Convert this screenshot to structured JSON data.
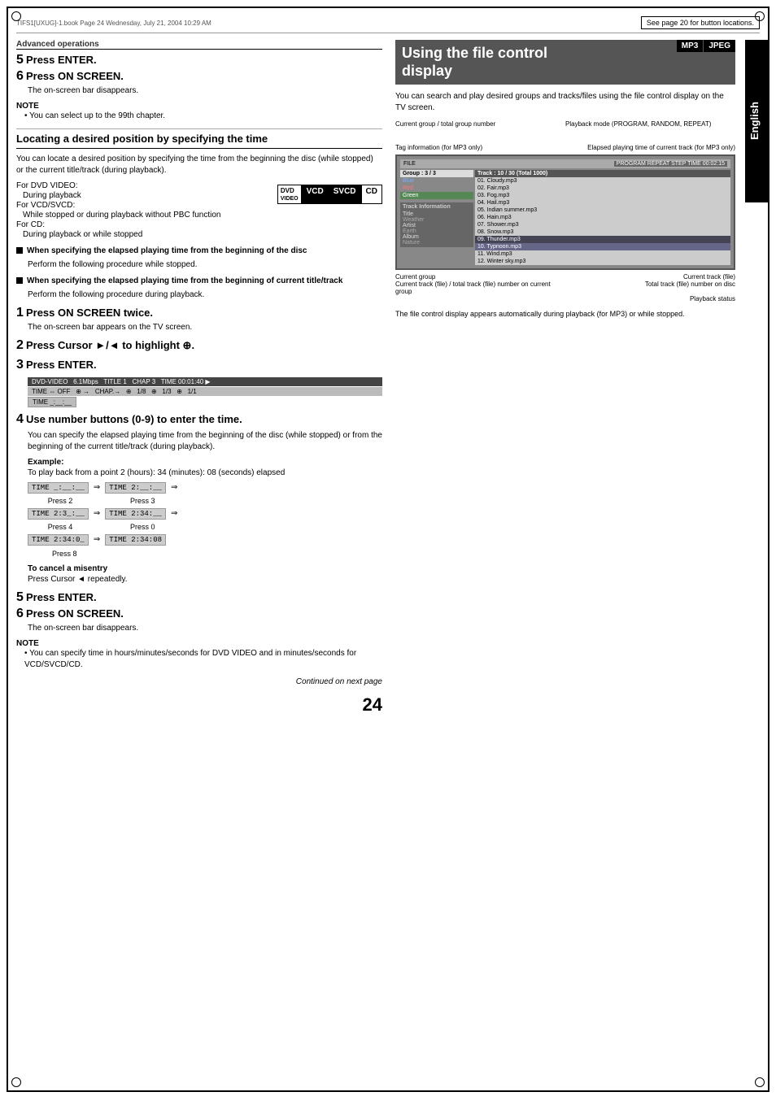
{
  "page": {
    "number": "24",
    "filename": "TIFS1[UXUG]-1.book  Page 24  Wednesday, July 21, 2004  10:29 AM",
    "see_page_note": "See page 20 for button locations.",
    "continued": "Continued on next page"
  },
  "left_column": {
    "section_header": "Advanced operations",
    "step5_num": "5",
    "step5_title": "Press ENTER.",
    "step6_num": "6",
    "step6_title": "Press ON SCREEN.",
    "step6_sub": "The on-screen bar disappears.",
    "note_label": "NOTE",
    "note_bullet": "You can select up to the 99th chapter.",
    "subsection_title": "Locating a desired position by specifying the time",
    "body_text1": "You can locate a desired position by specifying the time from the beginning the disc (while stopped) or the current title/track (during playback).",
    "for_dvd": "For DVD VIDEO:",
    "during_dvd": "During playback",
    "for_vcd": "For VCD/SVCD:",
    "during_vcd": "While stopped or during playback without PBC function",
    "for_cd": "For CD:",
    "during_cd": "During playback or while stopped",
    "bullet1_title": "When specifying the elapsed playing time from the beginning of the disc",
    "bullet1_sub": "Perform the following procedure while stopped.",
    "bullet2_title": "When specifying the elapsed playing time from the beginning of current title/track",
    "bullet2_sub": "Perform the following procedure during playback.",
    "step1_num": "1",
    "step1_title": "Press ON SCREEN twice.",
    "step1_sub": "The on-screen bar appears on the TV screen.",
    "step2_num": "2",
    "step2_title": "Press Cursor ►/◄ to highlight ⊕.",
    "step3_num": "3",
    "step3_title": "Press ENTER.",
    "dvd_bar": "DVD-VIDEO  6.1Mbps  TITLE 1  CHAP 3  TIME 00:01:40",
    "dvd_bar2": "TIME ⇔ OFF  ⊕ →  CHAP.→  ⊕  1/8  ⊕  1/3  ⊕  1/1",
    "dvd_bar3": "TIME _:__:__",
    "step4_num": "4",
    "step4_title": "Use number buttons (0-9) to enter the time.",
    "step4_body": "You can specify the elapsed playing time from the beginning of the disc (while stopped) or from the beginning of the current title/track (during playback).",
    "example_label": "Example:",
    "example_text": "To play back from a point 2 (hours): 34 (minutes): 08 (seconds) elapsed",
    "time_seq": [
      {
        "from": "TIME _:__:__",
        "to": "TIME 2:__:__",
        "press": "Press 2",
        "after_press": "Press 3"
      },
      {
        "from": "TIME 2:3_:__",
        "to": "TIME 2:34:__",
        "press": "Press 4",
        "after_press": "Press 0"
      },
      {
        "from": "TIME 2:34:0_",
        "to": "TIME 2:34:08",
        "press": "Press 8",
        "after_press": ""
      }
    ],
    "cancel_label": "To cancel a misentry",
    "cancel_text": "Press Cursor ◄ repeatedly.",
    "step5b_num": "5",
    "step5b_title": "Press ENTER.",
    "step6b_num": "6",
    "step6b_title": "Press ON SCREEN.",
    "step6b_sub": "The on-screen bar disappears.",
    "note2_label": "NOTE",
    "note2_bullet": "You can specify time in hours/minutes/seconds for DVD VIDEO and in minutes/seconds for VCD/SVCD/CD.",
    "format_badges": [
      "DVD VIDEO",
      "VCD",
      "SVCD",
      "CD"
    ]
  },
  "right_column": {
    "title_line1": "Using the file control",
    "title_line2": "display",
    "body_text": "You can search and play desired groups and tracks/files using the file control display on the TV screen.",
    "badges": [
      "MP3",
      "JPEG"
    ],
    "label_current_group": "Current group / total group number",
    "label_playback_mode": "Playback mode (PROGRAM, RANDOM, REPEAT)",
    "label_tag_info": "Tag information (for MP3 only)",
    "label_elapsed": "Elapsed playing time of current track (for MP3 only)",
    "screen": {
      "header_left": "FILE",
      "header_right": "PROGRAM  REPEAT  STEP  TIME 00:02:15",
      "group_header": "Group : 3 / 3",
      "track_header": "Track : 10 / 30  (Total 1000)",
      "groups": [
        "Blue",
        "Red",
        "Green"
      ],
      "tracks": [
        "01. Cloudy.mp3",
        "02. Fair.mp3",
        "03. Fog.mp3",
        "04. Hail.mp3",
        "05. Indian summer.mp3",
        "06. Hain.mp3",
        "07. Shower.mp3",
        "08. Snow.mp3",
        "09. Thunder.mp3",
        "10. Typnoon.mp3",
        "11. Wind.mp3",
        "12. Winter sky.mp3"
      ],
      "info_section": "Track Information",
      "info_rows": [
        {
          "label": "Title",
          "value": "Weather"
        },
        {
          "label": "Artist",
          "value": "Earth"
        },
        {
          "label": "Album",
          "value": "Nature"
        }
      ]
    },
    "label_current_group_bottom": "Current group",
    "label_current_track_bottom": "Current track (file)",
    "label_current_track_total": "Current track (file) / total track (file) number on current group",
    "label_total_track_disc": "Total track (file) number on disc",
    "label_playback_status": "Playback status",
    "bottom_note": "The file control display appears automatically during playback (for MP3) or while stopped."
  },
  "english_label": "English"
}
